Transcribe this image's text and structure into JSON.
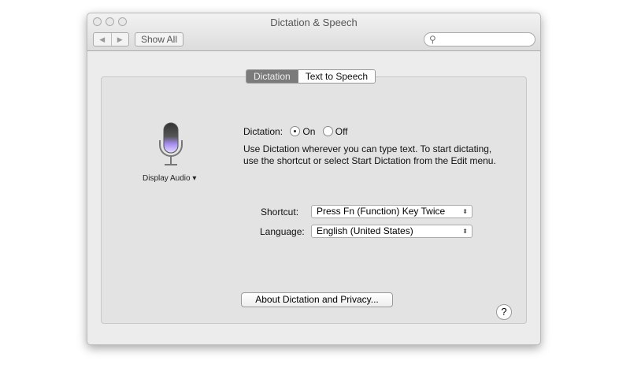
{
  "window": {
    "title": "Dictation & Speech",
    "show_all": "Show All",
    "back": "◀",
    "forward": "▶",
    "search_icon": "search-icon"
  },
  "tabs": [
    {
      "label": "Dictation",
      "active": true
    },
    {
      "label": "Text to Speech",
      "active": false
    }
  ],
  "mic": {
    "label": "Display Audio",
    "arrow": "▾"
  },
  "dictation": {
    "label": "Dictation:",
    "on": "On",
    "off": "Off",
    "selected": "On",
    "description": "Use Dictation wherever you can type text. To start dictating, use the shortcut or select Start Dictation from the Edit menu."
  },
  "shortcut": {
    "label": "Shortcut:",
    "value": "Press Fn (Function) Key Twice"
  },
  "language": {
    "label": "Language:",
    "value": "English (United States)"
  },
  "about_button": "About Dictation and Privacy...",
  "help": "?",
  "updown": "⬍"
}
